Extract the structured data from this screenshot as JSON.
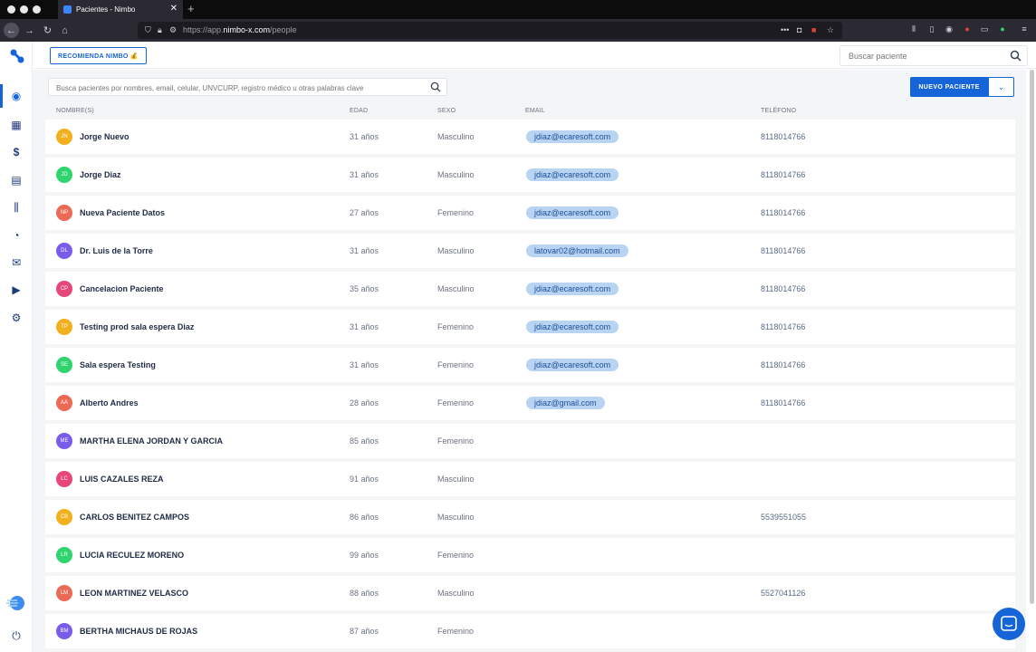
{
  "browser": {
    "tab_title": "Pacientes - Nimbo",
    "url_prefix": "https://app.",
    "url_domain": "nimbo-x.com",
    "url_path": "/people"
  },
  "topbar": {
    "recommend_label": "RECOMIENDA NIMBO 💰",
    "search_placeholder": "Buscar paciente"
  },
  "main": {
    "filter_placeholder": "Busca pacientes por nombres, email, celular, UNVCURP, registro médico u otras palabras clave",
    "new_patient_label": "NUEVO PACIENTE",
    "columns": {
      "name": "NOMBRE(S)",
      "age": "EDAD",
      "sex": "SEXO",
      "email": "EMAIL",
      "phone": "TELÉFONO"
    },
    "patients": [
      {
        "initials": "JN",
        "color": "#f2b01e",
        "name": "Jorge Nuevo",
        "age": "31 años",
        "sex": "Masculino",
        "email": "jdiaz@ecaresoft.com",
        "phone": "8118014766"
      },
      {
        "initials": "JD",
        "color": "#2fd46f",
        "name": "Jorge Diaz",
        "age": "31 años",
        "sex": "Masculino",
        "email": "jdiaz@ecaresoft.com",
        "phone": "8118014766"
      },
      {
        "initials": "NP",
        "color": "#ec6a55",
        "name": "Nueva Paciente Datos",
        "age": "27 años",
        "sex": "Femenino",
        "email": "jdiaz@ecaresoft.com",
        "phone": "8118014766"
      },
      {
        "initials": "DL",
        "color": "#7a5cec",
        "name": "Dr. Luis de la Torre",
        "age": "31 años",
        "sex": "Masculino",
        "email": "latovar02@hotmail.com",
        "phone": "8118014766"
      },
      {
        "initials": "CP",
        "color": "#e8457a",
        "name": "Cancelacion Paciente",
        "age": "35 años",
        "sex": "Masculino",
        "email": "jdiaz@ecaresoft.com",
        "phone": "8118014766"
      },
      {
        "initials": "TP",
        "color": "#f2b01e",
        "name": "Testing prod sala espera Diaz",
        "age": "31 años",
        "sex": "Femenino",
        "email": "jdiaz@ecaresoft.com",
        "phone": "8118014766"
      },
      {
        "initials": "SE",
        "color": "#2fd46f",
        "name": "Sala espera Testing",
        "age": "31 años",
        "sex": "Femenino",
        "email": "jdiaz@ecaresoft.com",
        "phone": "8118014766"
      },
      {
        "initials": "AA",
        "color": "#ec6a55",
        "name": "Alberto Andres",
        "age": "28 años",
        "sex": "Femenino",
        "email": "jdiaz@gmail.com",
        "phone": "8118014766"
      },
      {
        "initials": "ME",
        "color": "#7a5cec",
        "name": "MARTHA ELENA JORDAN Y GARCIA",
        "age": "85 años",
        "sex": "Femenino",
        "email": "",
        "phone": ""
      },
      {
        "initials": "LC",
        "color": "#e8457a",
        "name": "LUIS CAZALES REZA",
        "age": "91 años",
        "sex": "Masculino",
        "email": "",
        "phone": ""
      },
      {
        "initials": "CB",
        "color": "#f2b01e",
        "name": "CARLOS BENITEZ CAMPOS",
        "age": "86 años",
        "sex": "Masculino",
        "email": "",
        "phone": "5539551055"
      },
      {
        "initials": "LR",
        "color": "#2fd46f",
        "name": "LUCIA RECULEZ MORENO",
        "age": "99 años",
        "sex": "Femenino",
        "email": "",
        "phone": ""
      },
      {
        "initials": "LM",
        "color": "#ec6a55",
        "name": "LEON MARTINEZ VELASCO",
        "age": "88 años",
        "sex": "Masculino",
        "email": "",
        "phone": "5527041126"
      },
      {
        "initials": "BM",
        "color": "#7a5cec",
        "name": "BERTHA MICHAUS DE ROJAS",
        "age": "87 años",
        "sex": "Femenino",
        "email": "",
        "phone": ""
      }
    ]
  }
}
